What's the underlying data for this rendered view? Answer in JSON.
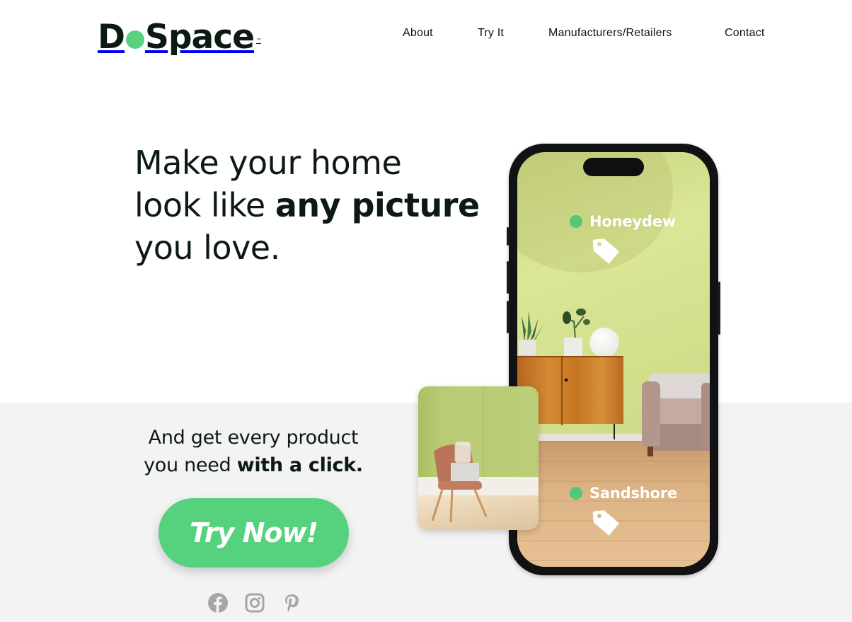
{
  "brand": {
    "logo_prefix": "D",
    "logo_suffix": "Space",
    "trademark": "™",
    "accent_color": "#56d17e",
    "text_color": "#0c1a12"
  },
  "nav": {
    "items": [
      {
        "label": "About"
      },
      {
        "label": "Try It"
      },
      {
        "label": "Manufacturers/Retailers"
      },
      {
        "label": "Contact"
      }
    ]
  },
  "hero": {
    "headline_line1": "Make your home",
    "headline_line2_regular": "look like ",
    "headline_line2_bold": "any picture",
    "headline_line3": "you love.",
    "sub_line1": "And get every product",
    "sub_line2_regular": "you need ",
    "sub_line2_bold": "with a click.",
    "cta_label": "Try Now!"
  },
  "phone": {
    "tags": [
      {
        "label": "Honeydew",
        "icon": "price-tag-icon"
      },
      {
        "label": "Sandshore",
        "icon": "price-tag-icon"
      }
    ]
  },
  "social": {
    "icons": [
      "facebook-icon",
      "instagram-icon",
      "pinterest-icon"
    ],
    "color": "#a6a6a6"
  }
}
